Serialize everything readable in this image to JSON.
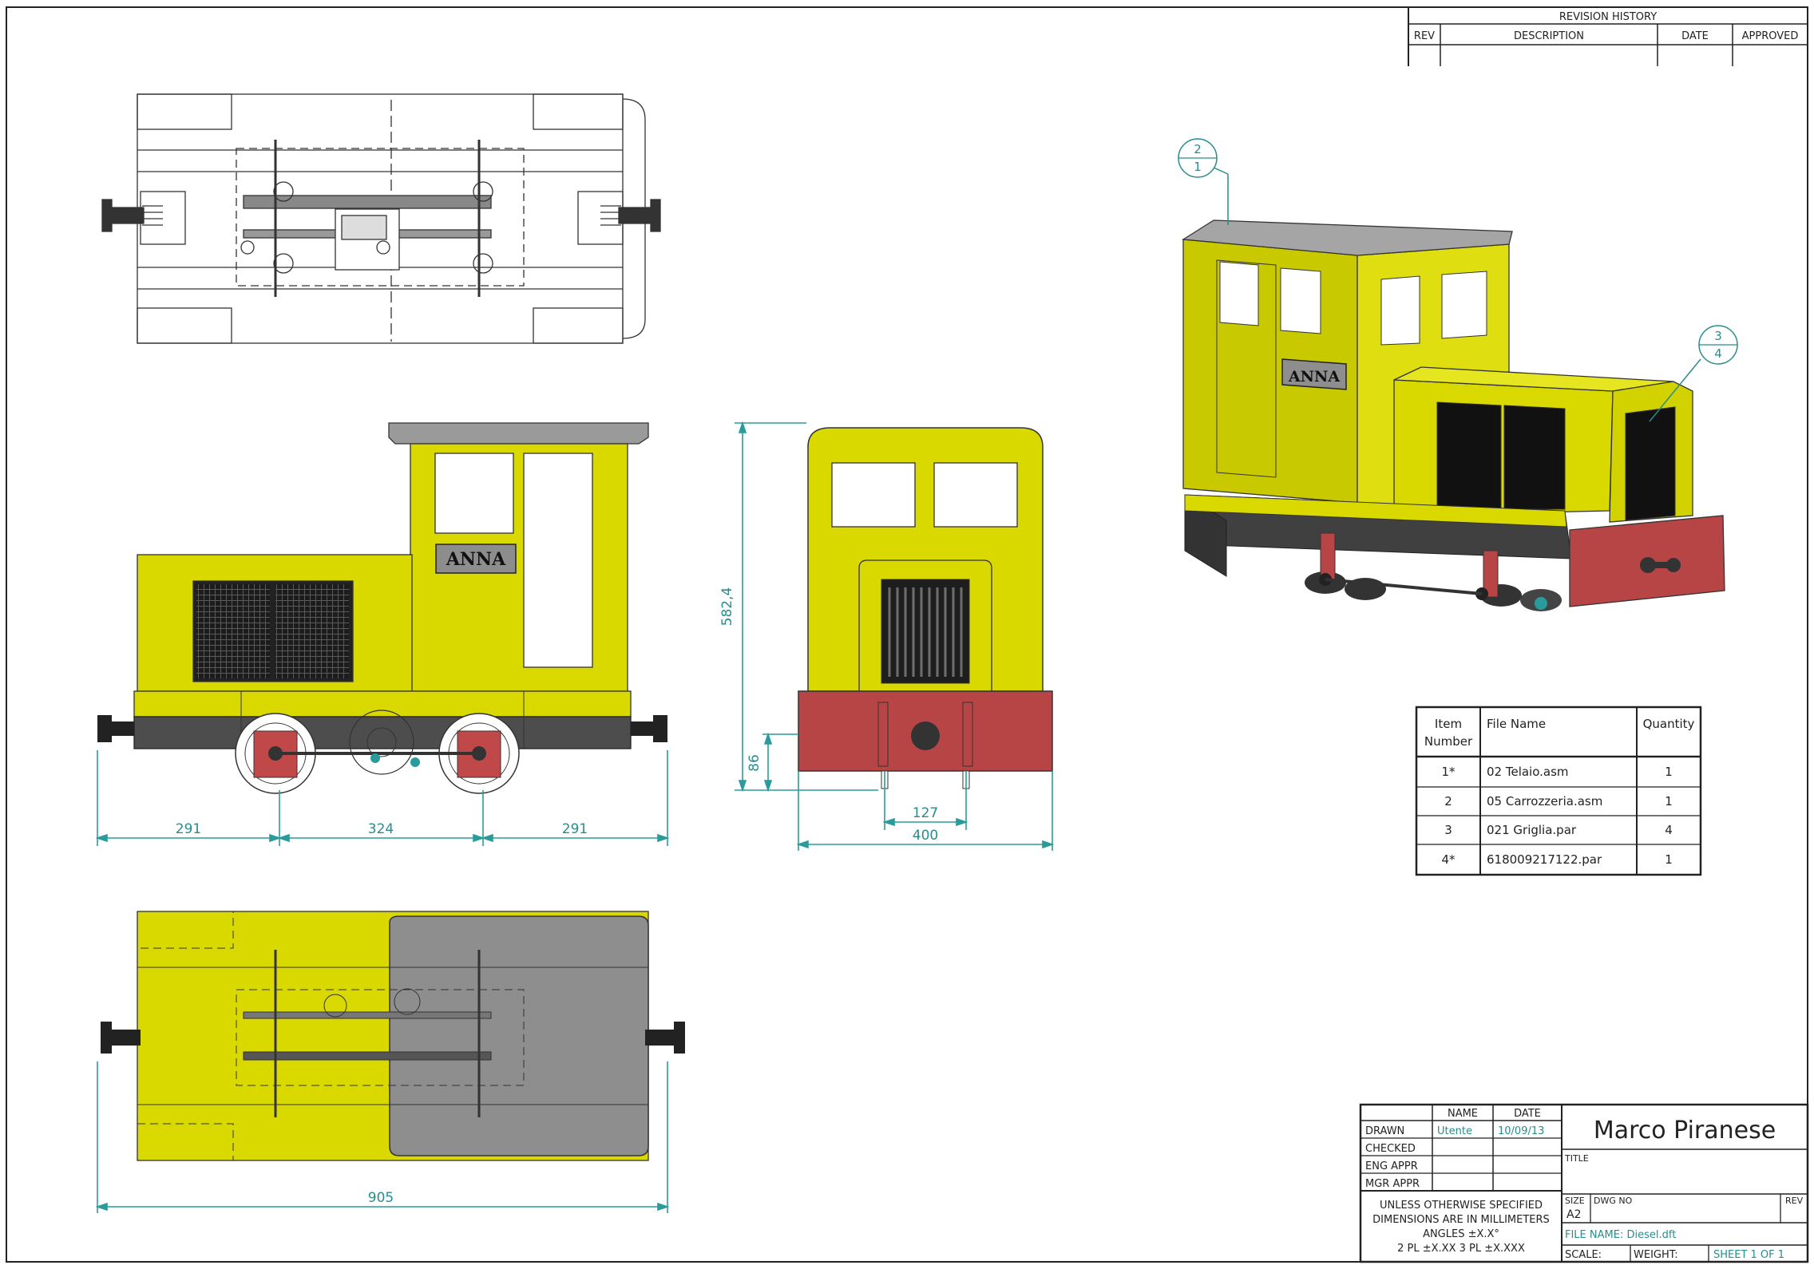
{
  "colors": {
    "body_yellow": "#d9d900",
    "buffer_red": "#b84545",
    "roof_gray": "#9a9a9a",
    "frame_dark": "#4d4d4d",
    "dimension_teal": "#2a9b9b"
  },
  "revision_history": {
    "title": "REVISION HISTORY",
    "headers": [
      "REV",
      "DESCRIPTION",
      "DATE",
      "APPROVED"
    ]
  },
  "side_view": {
    "nameplate": "ANNA",
    "dims": {
      "left": "291",
      "middle": "324",
      "right": "291"
    }
  },
  "front_view": {
    "dims": {
      "height": "582,4",
      "buffer_height": "86",
      "coupler_width": "127",
      "width": "400"
    }
  },
  "bottom_view": {
    "dims": {
      "length": "905"
    }
  },
  "iso_view": {
    "nameplate": "ANNA",
    "balloons": [
      {
        "top": "2",
        "bottom": "1"
      },
      {
        "top": "3",
        "bottom": "4"
      }
    ]
  },
  "parts_list": {
    "headers": {
      "item": "Item",
      "item2": "Number",
      "file": "File Name",
      "qty": "Quantity"
    },
    "rows": [
      {
        "item": "1*",
        "file": "02 Telaio.asm",
        "qty": "1"
      },
      {
        "item": "2",
        "file": "05 Carrozzeria.asm",
        "qty": "1"
      },
      {
        "item": "3",
        "file": "021 Griglia.par",
        "qty": "4"
      },
      {
        "item": "4*",
        "file": "618009217122.par",
        "qty": "1"
      }
    ]
  },
  "title_block": {
    "col_name": "NAME",
    "col_date": "DATE",
    "rows": [
      "DRAWN",
      "CHECKED",
      "ENG APPR",
      "MGR APPR"
    ],
    "drawn_name": "Utente",
    "drawn_date": "10/09/13",
    "company": "Marco Piranese",
    "title_label": "TITLE",
    "tolerance_lines": [
      "UNLESS OTHERWISE SPECIFIED",
      "DIMENSIONS ARE IN MILLIMETERS",
      "ANGLES ±X.X°",
      "2 PL ±X.XX 3 PL ±X.XXX"
    ],
    "size_label": "SIZE",
    "size_value": "A2",
    "dwg_no_label": "DWG NO",
    "rev_label": "REV",
    "file_name": "FILE NAME: Diesel.dft",
    "scale_label": "SCALE:",
    "weight_label": "WEIGHT:",
    "sheet": "SHEET 1 OF 1"
  }
}
